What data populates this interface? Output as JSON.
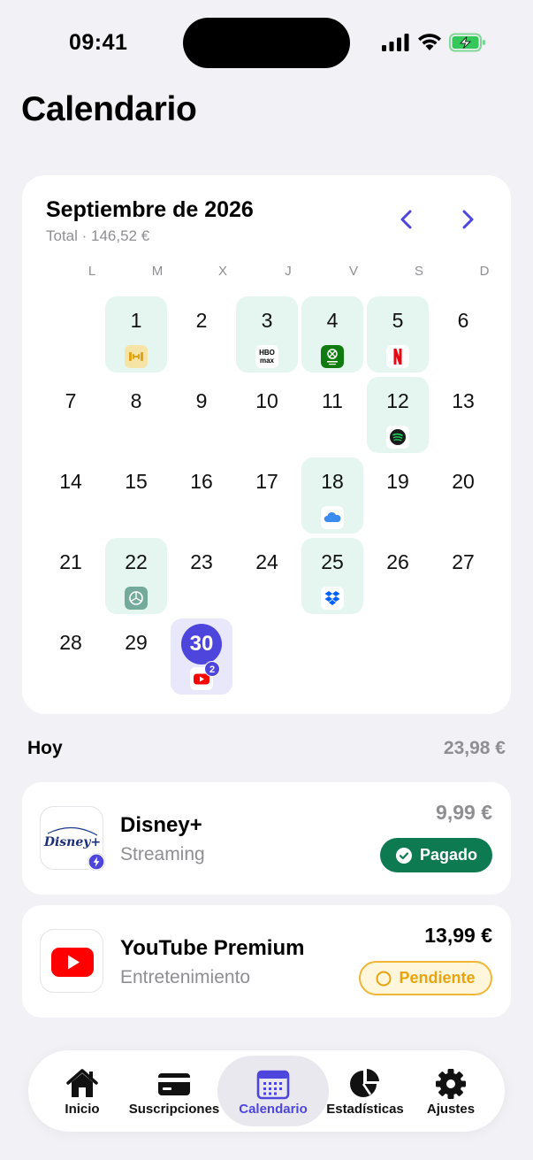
{
  "status_bar": {
    "time": "09:41"
  },
  "page": {
    "title": "Calendario"
  },
  "calendar": {
    "month_label": "Septiembre de 2026",
    "total_label": "Total · 146,52 €",
    "weekdays": [
      "L",
      "M",
      "X",
      "J",
      "V",
      "S",
      "D"
    ],
    "days": [
      "1",
      "2",
      "3",
      "4",
      "5",
      "6",
      "7",
      "8",
      "9",
      "10",
      "11",
      "12",
      "13",
      "14",
      "15",
      "16",
      "17",
      "18",
      "19",
      "20",
      "21",
      "22",
      "23",
      "24",
      "25",
      "26",
      "27",
      "28",
      "29",
      "30"
    ],
    "today_badge_count": "2",
    "subscription_days": [
      {
        "day": "1",
        "icon": "dumbbell-icon"
      },
      {
        "day": "3",
        "icon": "hbo-max-icon"
      },
      {
        "day": "4",
        "icon": "xbox-game-pass-icon"
      },
      {
        "day": "5",
        "icon": "netflix-icon"
      },
      {
        "day": "12",
        "icon": "spotify-icon"
      },
      {
        "day": "18",
        "icon": "icloud-icon"
      },
      {
        "day": "22",
        "icon": "chatgpt-icon"
      },
      {
        "day": "25",
        "icon": "dropbox-icon"
      },
      {
        "day": "30",
        "icon": "youtube-icon",
        "today": true
      }
    ],
    "colors": {
      "accent": "#4e46dc",
      "sub_bg": "#e5f5ef",
      "today_bg": "#e8e8fa"
    }
  },
  "today": {
    "label": "Hoy",
    "total": "23,98 €",
    "items": [
      {
        "name": "Disney+",
        "category": "Streaming",
        "price": "9,99 €",
        "status": "Pagado",
        "logo_text": "Disney+",
        "status_color": "#0e7a52"
      },
      {
        "name": "YouTube Premium",
        "category": "Entretenimiento",
        "price": "13,99 €",
        "status": "Pendiente",
        "status_color": "#e8a410"
      }
    ]
  },
  "tabbar": {
    "tabs": [
      {
        "label": "Inicio",
        "icon": "home-icon"
      },
      {
        "label": "Suscripciones",
        "icon": "card-icon"
      },
      {
        "label": "Calendario",
        "icon": "calendar-icon",
        "active": true
      },
      {
        "label": "Estadísticas",
        "icon": "pie-chart-icon"
      },
      {
        "label": "Ajustes",
        "icon": "gear-icon"
      }
    ]
  }
}
